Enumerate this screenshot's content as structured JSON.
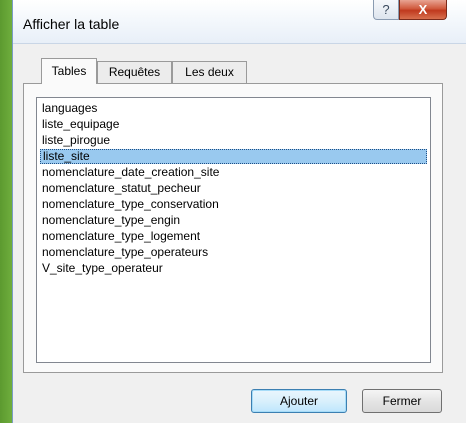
{
  "window": {
    "title": "Afficher la table",
    "help_glyph": "?",
    "close_glyph": "X"
  },
  "tabs": [
    {
      "label": "Tables",
      "active": true
    },
    {
      "label": "Requêtes",
      "active": false
    },
    {
      "label": "Les deux",
      "active": false
    }
  ],
  "tables": {
    "selected_index": 3,
    "items": [
      "languages",
      "liste_equipage",
      "liste_pirogue",
      "liste_site",
      "nomenclature_date_creation_site",
      "nomenclature_statut_pecheur",
      "nomenclature_type_conservation",
      "nomenclature_type_engin",
      "nomenclature_type_logement",
      "nomenclature_type_operateurs",
      "V_site_type_operateur"
    ]
  },
  "buttons": {
    "add_label": "Ajouter",
    "close_label": "Fermer"
  },
  "colors": {
    "selection": "#99c9ef",
    "close_button": "#c0391e",
    "desktop": "#6fae3c"
  }
}
